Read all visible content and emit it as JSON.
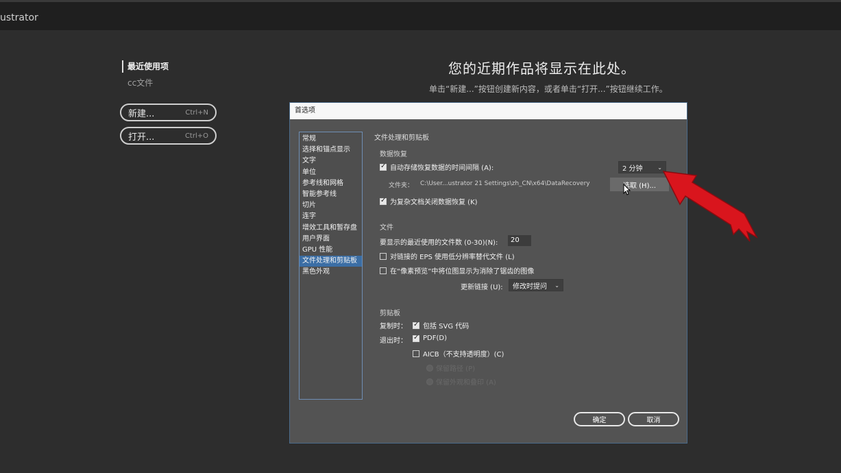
{
  "app": {
    "title": "ustrator"
  },
  "home": {
    "nav": {
      "recent": "最近使用项",
      "cc_files": "cc文件"
    },
    "buttons": {
      "new": {
        "label": "新建...",
        "shortcut": "Ctrl+N"
      },
      "open": {
        "label": "打开...",
        "shortcut": "Ctrl+O"
      }
    },
    "hero": {
      "title": "您的近期作品将显示在此处。",
      "subtitle": "单击“新建...”按钮创建新内容，或者单击“打开...”按钮继续工作。"
    }
  },
  "dialog": {
    "title": "首选项",
    "categories": [
      {
        "label": "常规",
        "selected": false
      },
      {
        "label": "选择和锚点显示",
        "selected": false
      },
      {
        "label": "文字",
        "selected": false
      },
      {
        "label": "单位",
        "selected": false
      },
      {
        "label": "参考线和网格",
        "selected": false
      },
      {
        "label": "智能参考线",
        "selected": false
      },
      {
        "label": "切片",
        "selected": false
      },
      {
        "label": "连字",
        "selected": false
      },
      {
        "label": "增效工具和暂存盘",
        "selected": false
      },
      {
        "label": "用户界面",
        "selected": false
      },
      {
        "label": "GPU 性能",
        "selected": false
      },
      {
        "label": "文件处理和剪贴板",
        "selected": true
      },
      {
        "label": "黑色外观",
        "selected": false
      }
    ],
    "panel_title": "文件处理和剪贴板",
    "recovery": {
      "title": "数据恢复",
      "autosave_label": "自动存储恢复数据的时间间隔 (A):",
      "autosave_checked": true,
      "interval_value": "2 分钟",
      "folder_label": "文件夹：",
      "folder_path": "C:\\User...ustrator 21 Settings\\zh_CN\\x64\\DataRecovery",
      "choose_button": "选取 (H)...",
      "complex_label": "为复杂文档关闭数据恢复 (K)",
      "complex_checked": true
    },
    "files": {
      "title": "文件",
      "recent_count_label": "要显示的最近使用的文件数 (0-30)(N):",
      "recent_count_value": "20",
      "eps_label": "对链接的 EPS 使用低分辨率替代文件 (L)",
      "eps_checked": false,
      "pixel_preview_label": "在“像素预览”中将位图显示为消除了锯齿的图像",
      "pixel_preview_checked": false,
      "update_links_label": "更新链接 (U):",
      "update_links_value": "修改时提问"
    },
    "clipboard": {
      "title": "剪贴板",
      "copy_label": "复制时：",
      "svg_label": "包括 SVG 代码",
      "svg_checked": true,
      "exit_label": "退出时：",
      "pdf_label": "PDF(D)",
      "pdf_checked": true,
      "aicb_label": "AICB（不支持透明度）(C)",
      "aicb_checked": false,
      "radio1_label": "保留路径 (P)",
      "radio2_label": "保留外观和叠印 (A)"
    },
    "ok_button": "确定",
    "cancel_button": "取消"
  },
  "colors": {
    "selection": "#3b6ea5",
    "arrow": "#d9151d"
  }
}
